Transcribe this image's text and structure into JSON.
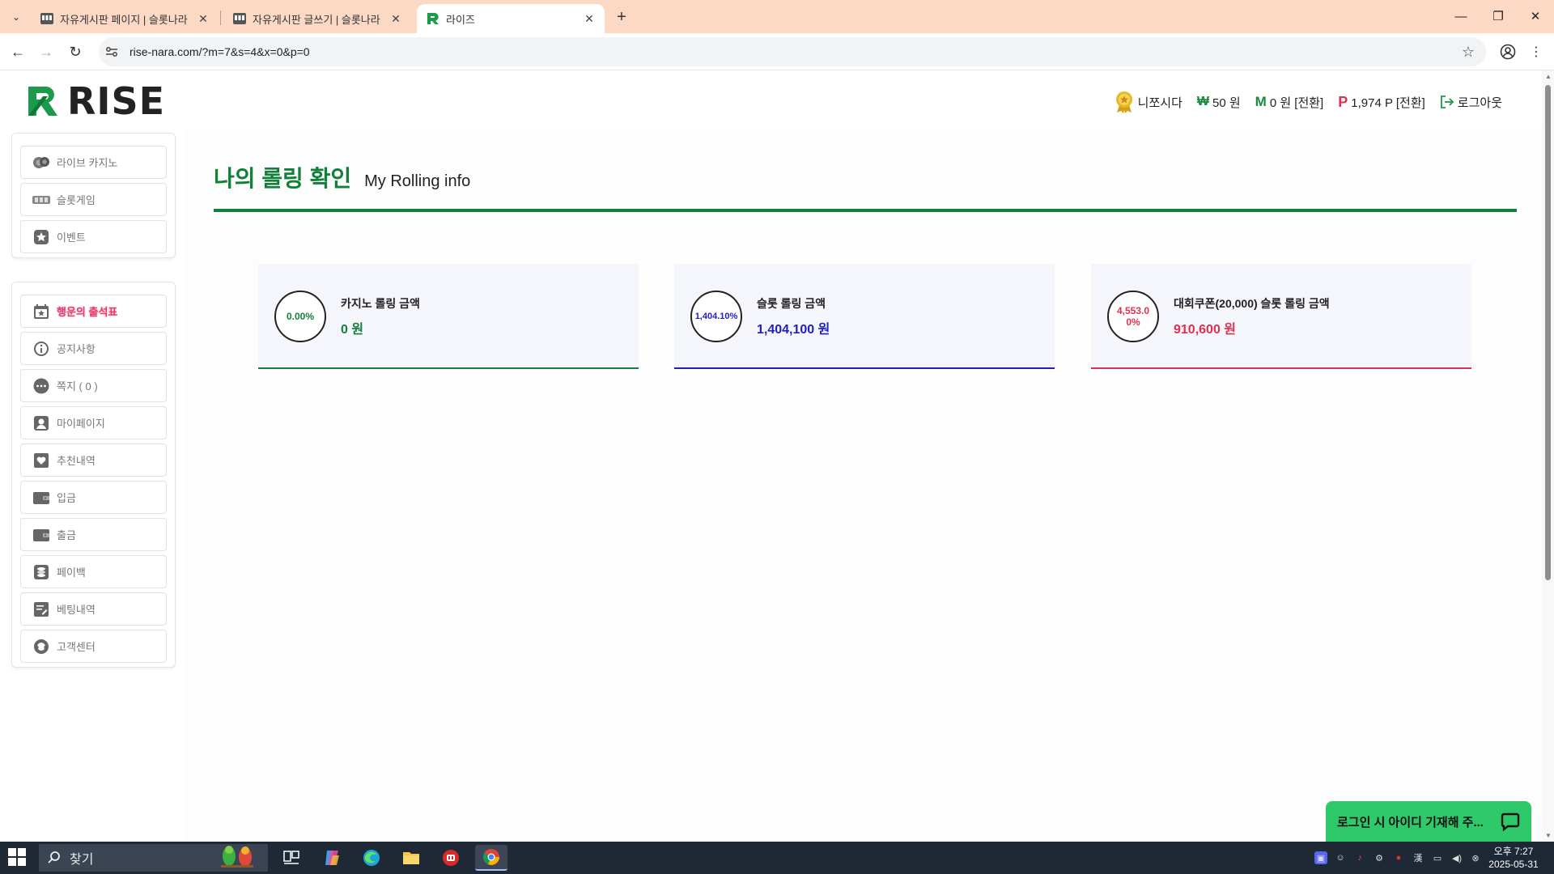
{
  "browser": {
    "tabs": [
      {
        "title": "자유게시판 페이지 | 슬롯나라",
        "active": false
      },
      {
        "title": "자유게시판 글쓰기 | 슬롯나라",
        "active": false
      },
      {
        "title": "라이즈",
        "active": true
      }
    ],
    "url": "rise-nara.com/?m=7&s=4&x=0&p=0"
  },
  "logo": {
    "text": "RISE"
  },
  "header": {
    "username": "니쪼시다",
    "won_symbol": "₩",
    "won_balance": "50 원",
    "m_symbol": "M",
    "m_balance": "0 원 [전환]",
    "p_symbol": "P",
    "p_balance": "1,974 P [전환]",
    "logout_label": "로그아웃"
  },
  "sidebar": {
    "group1": [
      {
        "label": "라이브 카지노",
        "icon": "chips-icon"
      },
      {
        "label": "슬롯게임",
        "icon": "slot-machine-icon"
      },
      {
        "label": "이벤트",
        "icon": "star-badge-icon"
      }
    ],
    "group2": [
      {
        "label": "행운의 출석표",
        "icon": "calendar-icon",
        "highlight": true
      },
      {
        "label": "공지사항",
        "icon": "info-icon"
      },
      {
        "label": "쪽지 ( 0 )",
        "icon": "chat-bubble-icon"
      },
      {
        "label": "마이페이지",
        "icon": "user-icon"
      },
      {
        "label": "추천내역",
        "icon": "heart-icon"
      },
      {
        "label": "입금",
        "icon": "wallet-icon"
      },
      {
        "label": "출금",
        "icon": "wallet-out-icon"
      },
      {
        "label": "페이백",
        "icon": "coin-stack-icon"
      },
      {
        "label": "베팅내역",
        "icon": "document-edit-icon"
      },
      {
        "label": "고객센터",
        "icon": "headset-icon"
      }
    ]
  },
  "main": {
    "title_ko": "나의 롤링 확인",
    "title_en": "My Rolling info",
    "cards": [
      {
        "percent": "0.00%",
        "label": "카지노 롤링 금액",
        "value": "0 원",
        "color": "#13803a"
      },
      {
        "percent": "1,404.10%",
        "label": "슬롯 롤링 금액",
        "value": "1,404,100 원",
        "color": "#2020c0"
      },
      {
        "percent": "4,553.00%",
        "label": "대회쿠폰(20,000) 슬롯 롤링 금액",
        "value": "910,600 원",
        "color": "#e03050"
      }
    ]
  },
  "chat_widget": {
    "text": "로그인 시 아이디 기재해 주..."
  },
  "taskbar": {
    "search_placeholder": "찾기",
    "clock_time": "오후 7:27",
    "clock_date": "2025-05-31"
  },
  "colors": {
    "brand_green": "#13803a",
    "slot_blue": "#2020c0",
    "coupon_red": "#e03050",
    "tabbar": "#fcd9c4"
  }
}
